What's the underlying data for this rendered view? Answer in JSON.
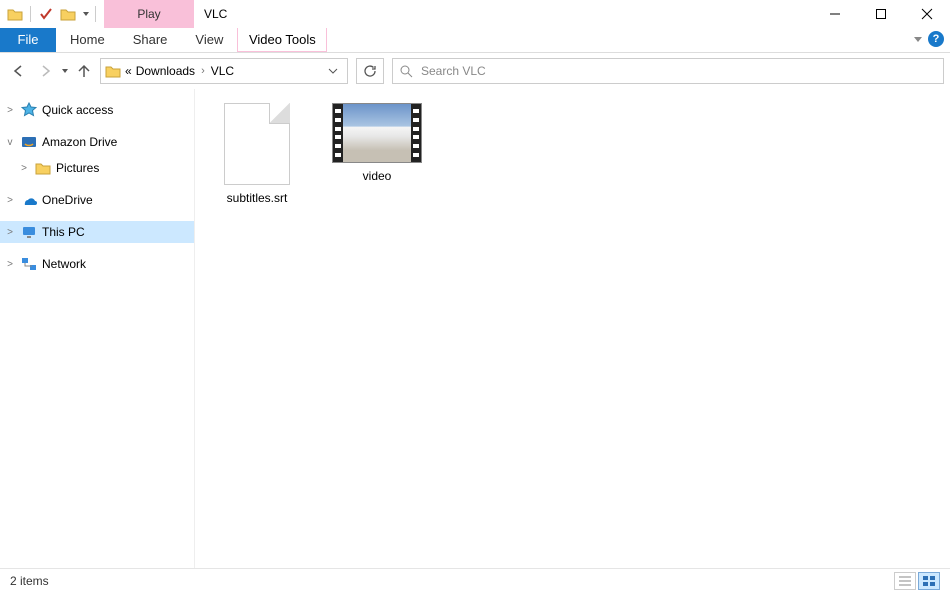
{
  "title": "VLC",
  "ribbon": {
    "contextual_label": "Play",
    "contextual_tab": "Video Tools",
    "file": "File",
    "tabs": [
      "Home",
      "Share",
      "View"
    ]
  },
  "address": {
    "prefix": "«",
    "crumbs": [
      "Downloads",
      "VLC"
    ]
  },
  "search": {
    "placeholder": "Search VLC"
  },
  "tree": [
    {
      "label": "Quick access",
      "icon": "star",
      "expander": ">",
      "indent": 0
    },
    {
      "label": "Amazon Drive",
      "icon": "drive-amazon",
      "expander": "v",
      "indent": 0
    },
    {
      "label": "Pictures",
      "icon": "folder",
      "expander": ">",
      "indent": 1
    },
    {
      "label": "OneDrive",
      "icon": "cloud",
      "expander": ">",
      "indent": 0
    },
    {
      "label": "This PC",
      "icon": "pc",
      "expander": ">",
      "indent": 0,
      "selected": true
    },
    {
      "label": "Network",
      "icon": "network",
      "expander": ">",
      "indent": 0
    }
  ],
  "files": [
    {
      "name": "subtitles.srt",
      "type": "document"
    },
    {
      "name": "video",
      "type": "video"
    }
  ],
  "status": {
    "text": "2 items"
  }
}
